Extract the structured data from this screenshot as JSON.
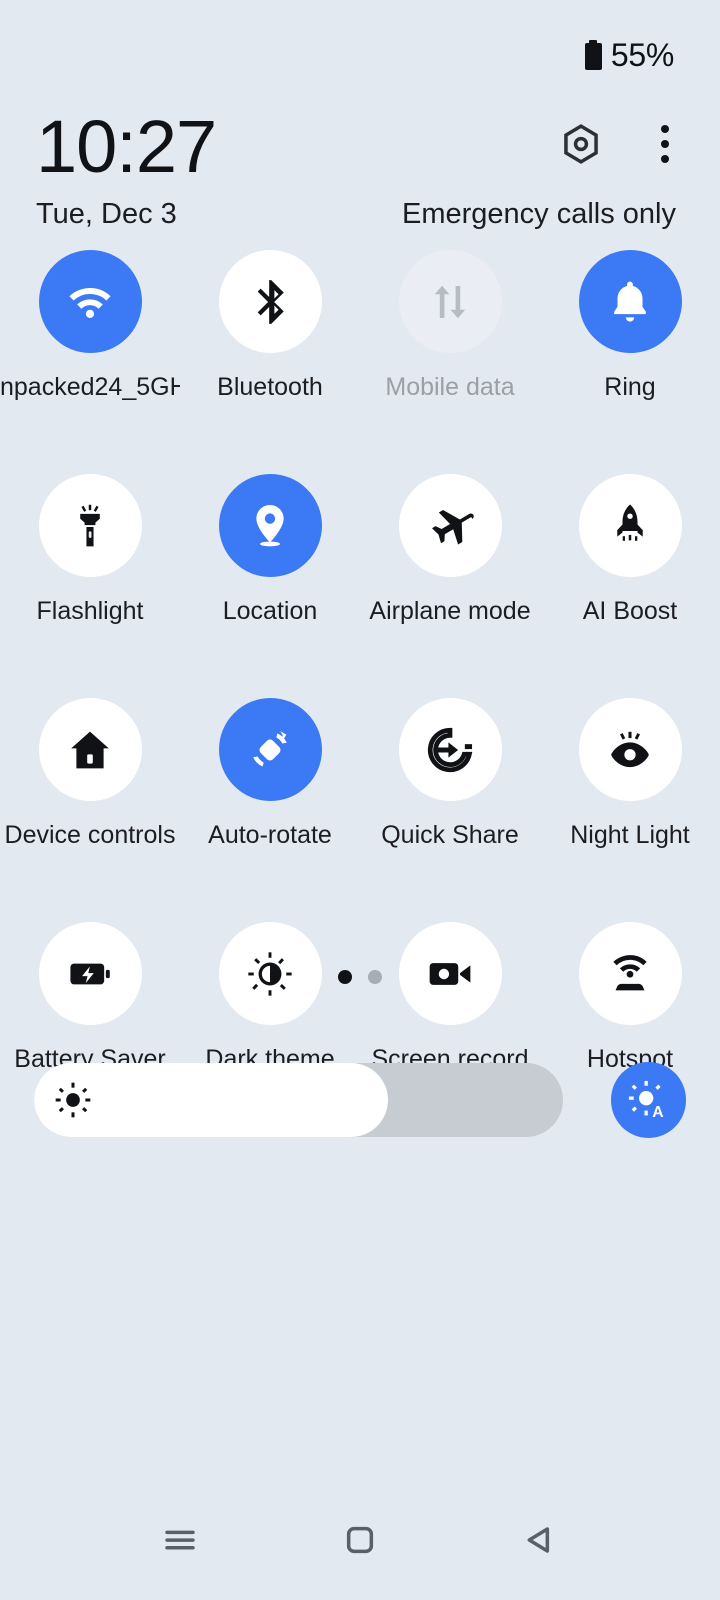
{
  "status_bar": {
    "battery_percent": "55%",
    "battery_icon": "battery-icon"
  },
  "header": {
    "time": "10:27",
    "date": "Tue, Dec 3",
    "carrier_status": "Emergency calls only",
    "settings_icon": "hex-settings-icon",
    "overflow_icon": "kebab-menu-icon"
  },
  "colors": {
    "background": "#e3e9f0",
    "accent": "#3b79f5",
    "tile_inactive": "#ffffff",
    "tile_disabled": "#eaeef4",
    "text": "#1b1d21",
    "text_disabled": "#9aa0a6",
    "slider_track": "#c7ccd3",
    "slider_fill": "#ffffff",
    "nav_icon": "#5a6069"
  },
  "tiles": [
    {
      "label": "npacked24_5GH",
      "icon": "wifi-icon",
      "state": "active"
    },
    {
      "label": "Bluetooth",
      "icon": "bluetooth-icon",
      "state": "inactive"
    },
    {
      "label": "Mobile data",
      "icon": "mobile-data-icon",
      "state": "disabled"
    },
    {
      "label": "Ring",
      "icon": "bell-icon",
      "state": "active"
    },
    {
      "label": "Flashlight",
      "icon": "flashlight-icon",
      "state": "inactive"
    },
    {
      "label": "Location",
      "icon": "location-pin-icon",
      "state": "active"
    },
    {
      "label": "Airplane mode",
      "icon": "airplane-icon",
      "state": "inactive"
    },
    {
      "label": "AI Boost",
      "icon": "rocket-icon",
      "state": "inactive"
    },
    {
      "label": "Device controls",
      "icon": "home-icon",
      "state": "inactive"
    },
    {
      "label": "Auto-rotate",
      "icon": "auto-rotate-icon",
      "state": "active"
    },
    {
      "label": "Quick Share",
      "icon": "quick-share-icon",
      "state": "inactive"
    },
    {
      "label": "Night Light",
      "icon": "eye-icon",
      "state": "inactive"
    },
    {
      "label": "Battery Saver",
      "icon": "battery-saver-icon",
      "state": "inactive"
    },
    {
      "label": "Dark theme",
      "icon": "dark-theme-icon",
      "state": "inactive"
    },
    {
      "label": "Screen record",
      "icon": "video-camera-icon",
      "state": "inactive"
    },
    {
      "label": "Hotspot",
      "icon": "hotspot-icon",
      "state": "inactive"
    }
  ],
  "page_indicator": {
    "total": 2,
    "active_index": 0
  },
  "brightness": {
    "value_percent": 67,
    "slider_icon": "brightness-sun-icon",
    "auto_button_icon": "auto-brightness-icon",
    "auto_button_label": "A"
  },
  "nav_bar": {
    "buttons": [
      {
        "icon": "recents-menu-icon"
      },
      {
        "icon": "home-square-icon"
      },
      {
        "icon": "back-triangle-icon"
      }
    ]
  }
}
